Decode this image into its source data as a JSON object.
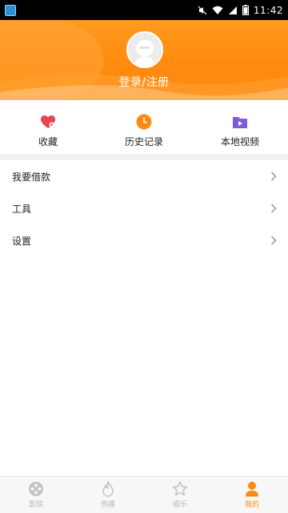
{
  "status_bar": {
    "time": "11:42"
  },
  "header": {
    "login_label": "登录/注册"
  },
  "quick_actions": [
    {
      "label": "收藏",
      "icon": "heart-icon",
      "color": "#e8454a"
    },
    {
      "label": "历史记录",
      "icon": "clock-icon",
      "color": "#ff8a0f"
    },
    {
      "label": "本地视频",
      "icon": "folder-video-icon",
      "color": "#7b5cd6"
    }
  ],
  "menu": [
    {
      "label": "我要借款"
    },
    {
      "label": "工具"
    },
    {
      "label": "设置"
    }
  ],
  "bottom_nav": [
    {
      "label": "影院",
      "icon": "film-reel-icon",
      "active": false
    },
    {
      "label": "热播",
      "icon": "flame-icon",
      "active": false
    },
    {
      "label": "娱乐",
      "icon": "star-icon",
      "active": false
    },
    {
      "label": "我的",
      "icon": "person-icon",
      "active": true
    }
  ],
  "colors": {
    "accent": "#ff8a0f",
    "inactive": "#b8b8b8"
  }
}
